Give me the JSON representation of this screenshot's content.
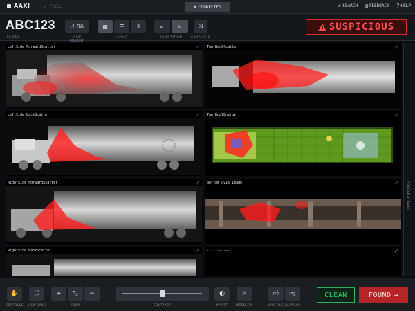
{
  "topbar": {
    "brand": "AAXI",
    "brand_sub": "PIXEL",
    "connected": "CONNECTED",
    "links": [
      {
        "label": "SEARCH",
        "icon": "search-icon"
      },
      {
        "label": "FEEDBACK",
        "icon": "feedback-icon"
      },
      {
        "label": "HELP",
        "icon": "help-icon"
      }
    ]
  },
  "subbar": {
    "plate": "ABC123",
    "plate_label": "PLATE#",
    "view_history_count": "06",
    "labels": {
      "view_history": "VIEW HISTORY",
      "layout": "LAYOUT",
      "orientation": "ORIENTATION",
      "compare": "COMPARE 2"
    },
    "status": "SUSPICIOUS"
  },
  "panels": [
    {
      "title": "LeftSide ForwardScatter"
    },
    {
      "title": "Top BackScatter"
    },
    {
      "title": "LeftSide BackScatter"
    },
    {
      "title": "Top DualEnergy"
    },
    {
      "title": "RightSide ForwardScatter"
    },
    {
      "title": "Bottom Uvis Image"
    },
    {
      "title": "RightSide BackScatter"
    },
    {
      "title": "--- --- ---"
    }
  ],
  "side_tab": "TOGGLE AI BANK",
  "bottombar": {
    "labels": {
      "controls": "CONTROLS",
      "view_sync": "VIEW SYNC",
      "zoom": "ZOOM",
      "contrast": "CONTRAST",
      "invert": "INVERT",
      "intensity": "INTENSITY",
      "helpful": "WAS THIS HELPFUL?"
    },
    "contrast_level": 0.5,
    "clean": "CLEAN",
    "found": "FOUND"
  },
  "colors": {
    "alert": "#d42a2a",
    "clean": "#2bb35a",
    "found": "#b52426"
  }
}
